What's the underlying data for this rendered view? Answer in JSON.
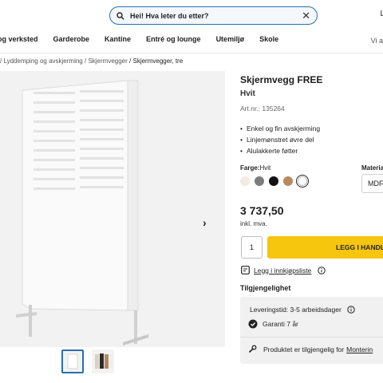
{
  "search": {
    "placeholder": "Hei! Hva leter du etter?"
  },
  "header": {
    "login_label": "L"
  },
  "nav": {
    "items": [
      "og verksted",
      "Garderobe",
      "Kantine",
      "Entré og lounge",
      "Utemiljø",
      "Skole"
    ],
    "right_label": "Vi a"
  },
  "breadcrumb": {
    "parts": [
      "/ Lyddemping og avskjerming",
      "/ Skjermvegger",
      "/ Skjermvegger, tre"
    ]
  },
  "product": {
    "title": "Skjermvegg FREE",
    "color_name": "Hvit",
    "artnr": "Art.nr.: 135264",
    "bullets": [
      "Enkel og fin avskjerming",
      "Linjemønstret øvre del",
      "Alulakkerte føtter"
    ],
    "color_label": "Farge:",
    "color_value": "Hvit",
    "swatches": [
      "#f1ece2",
      "#7c7c7c",
      "#121212",
      "#b98a5e",
      "#ffffff"
    ],
    "material_label": "Materia",
    "material_value": "MDF",
    "price": "3 737,50",
    "vat": "inkl. mva.",
    "quantity": "1",
    "buy_label": "LEGG I HANDL",
    "wishlist_label": "Legg i innkjøpsliste"
  },
  "availability": {
    "heading": "Tilgjengelighet",
    "delivery": "Leveringstid: 3-5 arbeidsdager",
    "warranty": "Garanti 7 år",
    "mounting_text": "Produktet er tilgjengelig for",
    "mounting_link": "Monterin"
  },
  "description_cut": "",
  "colors": {
    "accent": "#2a6fb0",
    "buy": "#f6c60e"
  }
}
